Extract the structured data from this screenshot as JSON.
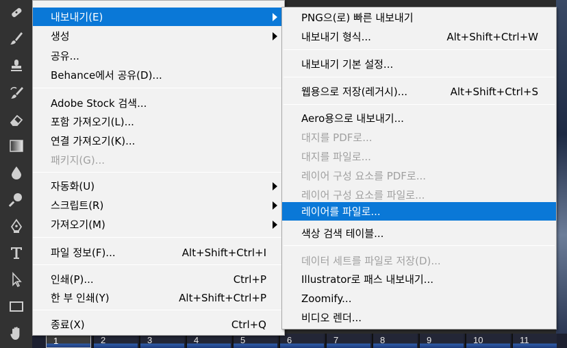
{
  "toolbar": {
    "tools": [
      "healing-brush-icon",
      "brush-icon",
      "clone-stamp-icon",
      "history-brush-icon",
      "eraser-icon",
      "gradient-icon",
      "blur-icon",
      "dodge-icon",
      "pen-icon",
      "type-icon",
      "path-selection-icon",
      "rectangle-icon",
      "hand-icon"
    ]
  },
  "main_menu": {
    "items": [
      {
        "label": "내보내기(E)",
        "shortcut": "",
        "submenu": true
      },
      {
        "label": "생성",
        "shortcut": "",
        "submenu": true
      },
      {
        "label": "공유...",
        "shortcut": ""
      },
      {
        "label": "Behance에서 공유(D)...",
        "shortcut": ""
      },
      {
        "label": "Adobe Stock 검색...",
        "shortcut": ""
      },
      {
        "label": "포함 가져오기(L)...",
        "shortcut": ""
      },
      {
        "label": "연결 가져오기(K)...",
        "shortcut": ""
      },
      {
        "label": "패키지(G)...",
        "shortcut": "",
        "disabled": true
      },
      {
        "label": "자동화(U)",
        "shortcut": "",
        "submenu": true
      },
      {
        "label": "스크립트(R)",
        "shortcut": "",
        "submenu": true
      },
      {
        "label": "가져오기(M)",
        "shortcut": "",
        "submenu": true
      },
      {
        "label": "파일 정보(F)...",
        "shortcut": "Alt+Shift+Ctrl+I"
      },
      {
        "label": "인쇄(P)...",
        "shortcut": "Ctrl+P"
      },
      {
        "label": "한 부 인쇄(Y)",
        "shortcut": "Alt+Shift+Ctrl+P"
      },
      {
        "label": "종료(X)",
        "shortcut": "Ctrl+Q"
      }
    ]
  },
  "sub_menu": {
    "items": [
      {
        "label": "PNG으(로) 빠른 내보내기",
        "shortcut": ""
      },
      {
        "label": "내보내기 형식...",
        "shortcut": "Alt+Shift+Ctrl+W"
      },
      {
        "label": "내보내기 기본 설정...",
        "shortcut": ""
      },
      {
        "label": "웹용으로 저장(레거시)...",
        "shortcut": "Alt+Shift+Ctrl+S"
      },
      {
        "label": "Aero용으로 내보내기...",
        "shortcut": ""
      },
      {
        "label": "대지를 PDF로...",
        "shortcut": "",
        "disabled": true
      },
      {
        "label": "대지를 파일로...",
        "shortcut": "",
        "disabled": true
      },
      {
        "label": "레이어 구성 요소를 PDF로...",
        "shortcut": "",
        "disabled": true
      },
      {
        "label": "레이어 구성 요소를 파일로...",
        "shortcut": "",
        "disabled": true
      },
      {
        "label": "레이어를 파일로...",
        "shortcut": "",
        "highlighted": true
      },
      {
        "label": "색상 검색 테이블...",
        "shortcut": ""
      },
      {
        "label": "데이터 세트를 파일로 저장(D)...",
        "shortcut": "",
        "disabled": true
      },
      {
        "label": "Illustrator로 패스 내보내기...",
        "shortcut": ""
      },
      {
        "label": "Zoomify...",
        "shortcut": ""
      },
      {
        "label": "비디오 렌더...",
        "shortcut": ""
      }
    ]
  },
  "filmstrip": {
    "frames": [
      "1",
      "2",
      "3",
      "4",
      "5",
      "6",
      "7",
      "8",
      "9",
      "10",
      "11"
    ]
  },
  "colors": {
    "highlight": "#0a78d7",
    "menu_bg": "#f2f2f2",
    "disabled_text": "#a0a0a0"
  }
}
